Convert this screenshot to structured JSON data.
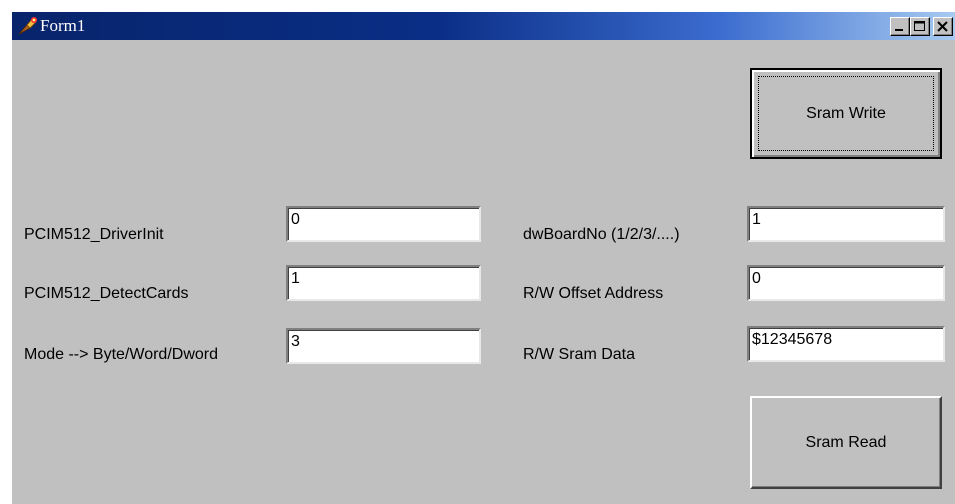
{
  "window": {
    "title": "Form1",
    "controls": [
      "minimize-icon",
      "maximize-icon",
      "close-icon"
    ],
    "titlebar_colors": [
      "#08246b",
      "#a6caf0"
    ],
    "face_color": "#c0c0c0"
  },
  "left_fields": [
    {
      "label": "PCIM512_DriverInit",
      "value": "0"
    },
    {
      "label": "PCIM512_DetectCards",
      "value": "1"
    },
    {
      "label": "Mode --> Byte/Word/Dword",
      "value": "3"
    }
  ],
  "right_fields": [
    {
      "label": "dwBoardNo  (1/2/3/....)",
      "value": "1"
    },
    {
      "label": "R/W Offset Address",
      "value": "0"
    },
    {
      "label": "R/W  Sram Data",
      "value": "$12345678"
    }
  ],
  "buttons": {
    "write": "Sram Write",
    "read": "Sram Read"
  }
}
